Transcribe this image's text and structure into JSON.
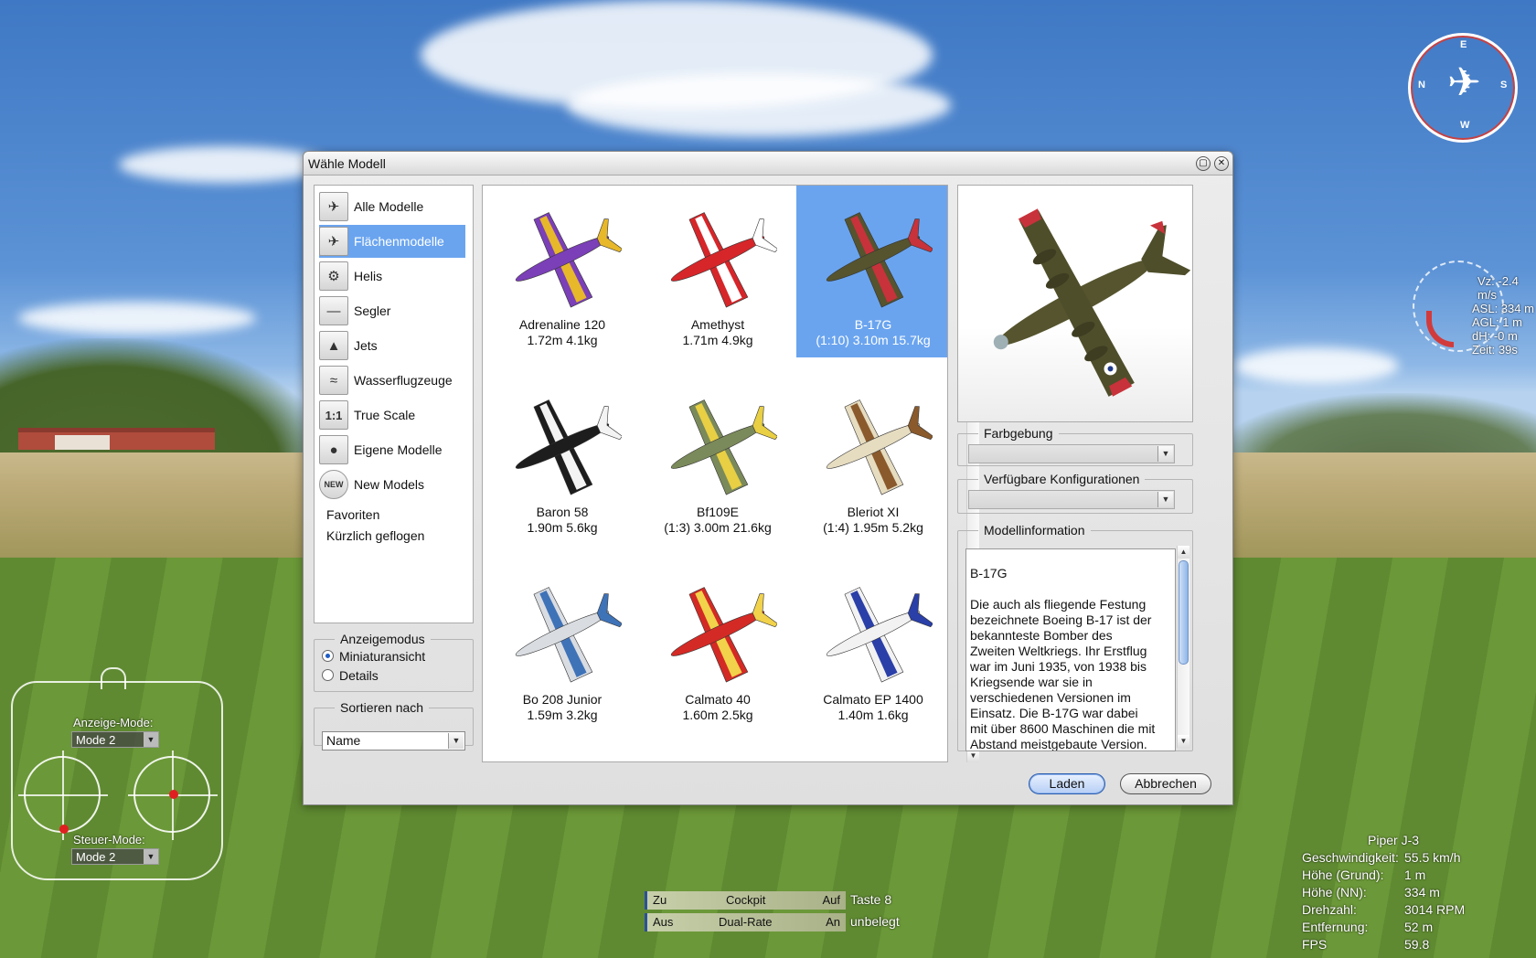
{
  "dialog": {
    "title": "Wähle Modell",
    "categories": [
      {
        "label": "Alle Modelle",
        "icon": "all-models-icon",
        "glyph": "✈"
      },
      {
        "label": "Flächenmodelle",
        "icon": "airplane-icon",
        "glyph": "✈"
      },
      {
        "label": "Helis",
        "icon": "helicopter-icon",
        "glyph": "⚙"
      },
      {
        "label": "Segler",
        "icon": "glider-icon",
        "glyph": "—"
      },
      {
        "label": "Jets",
        "icon": "jet-icon",
        "glyph": "▲"
      },
      {
        "label": "Wasserflugzeuge",
        "icon": "seaplane-icon",
        "glyph": "≈"
      },
      {
        "label": "True Scale",
        "icon": "true-scale-icon",
        "glyph": "1:1"
      },
      {
        "label": "Eigene Modelle",
        "icon": "user-icon",
        "glyph": "●"
      },
      {
        "label": "New Models",
        "icon": "new-badge-icon",
        "glyph": "NEW"
      }
    ],
    "text_links": [
      "Favoriten",
      "Kürzlich geflogen"
    ],
    "display_mode": {
      "legend": "Anzeigemodus",
      "options": [
        "Miniaturansicht",
        "Details"
      ],
      "selected": "Miniaturansicht"
    },
    "sort": {
      "legend": "Sortieren nach",
      "value": "Name"
    },
    "models": [
      {
        "name": "Adrenaline 120",
        "spec": "1.72m 4.1kg",
        "color": "#7b3fb8",
        "accent": "#e7b82a"
      },
      {
        "name": "Amethyst",
        "spec": "1.71m 4.9kg",
        "color": "#d6262a",
        "accent": "#ffffff"
      },
      {
        "name": "B-17G",
        "spec": "(1:10) 3.10m 15.7kg",
        "color": "#55542e",
        "accent": "#c8323a"
      },
      {
        "name": "Baron 58",
        "spec": "1.90m 5.6kg",
        "color": "#1d1d1d",
        "accent": "#f3f3f3"
      },
      {
        "name": "Bf109E",
        "spec": "(1:3) 3.00m 21.6kg",
        "color": "#7b8a5a",
        "accent": "#e8cf43"
      },
      {
        "name": "Bleriot XI",
        "spec": "(1:4) 1.95m 5.2kg",
        "color": "#e6dcc0",
        "accent": "#8a5a2c"
      },
      {
        "name": "Bo 208 Junior",
        "spec": "1.59m 3.2kg",
        "color": "#d9dde2",
        "accent": "#3f73b8"
      },
      {
        "name": "Calmato 40",
        "spec": "1.60m 2.5kg",
        "color": "#d42a25",
        "accent": "#f1d24a"
      },
      {
        "name": "Calmato EP 1400",
        "spec": "1.40m 1.6kg",
        "color": "#f2f2f2",
        "accent": "#2a3fa8"
      }
    ],
    "selected_model": "B-17G",
    "color_scheme": {
      "legend": "Farbgebung",
      "value": ""
    },
    "configurations": {
      "legend": "Verfügbare Konfigurationen",
      "value": ""
    },
    "model_info": {
      "legend": "Modellinformation",
      "heading": "B-17G",
      "text": "Die auch als fliegende Festung bezeichnete Boeing B-17 ist der bekannteste Bomber des Zweiten Weltkriegs. Ihr Erstflug war im Juni 1935, von 1938 bis Kriegsende war sie in verschiedenen Versionen im Einsatz. Die B-17G war dabei mit über 8600 Maschinen die mit Abstand meistgebaute Version."
    },
    "buttons": {
      "load": "Laden",
      "cancel": "Abbrechen"
    }
  },
  "transmitter": {
    "display_mode_label": "Anzeige-Mode:",
    "display_mode_value": "Mode 2",
    "control_mode_label": "Steuer-Mode:",
    "control_mode_value": "Mode 2"
  },
  "switches": [
    {
      "left": "Zu",
      "center": "Cockpit",
      "right": "Auf",
      "note": "Taste 8"
    },
    {
      "left": "Aus",
      "center": "Dual-Rate",
      "right": "An",
      "note": "unbelegt"
    }
  ],
  "vario": [
    "Vz: -2.4 m/s",
    "ASL: 334 m",
    "AGL: 1 m",
    "dH: -0 m",
    "Zeit: 39s"
  ],
  "compass": {
    "n": "N",
    "e": "E",
    "s": "S",
    "w": "W"
  },
  "telemetry": {
    "title": "Piper J-3",
    "rows": [
      {
        "k": "Geschwindigkeit:",
        "v": "55.5 km/h"
      },
      {
        "k": "Höhe (Grund):",
        "v": "1 m"
      },
      {
        "k": "Höhe (NN):",
        "v": "334 m"
      },
      {
        "k": "Drehzahl:",
        "v": "3014 RPM"
      },
      {
        "k": "Entfernung:",
        "v": "52 m"
      },
      {
        "k": "FPS",
        "v": "59.8"
      }
    ]
  }
}
